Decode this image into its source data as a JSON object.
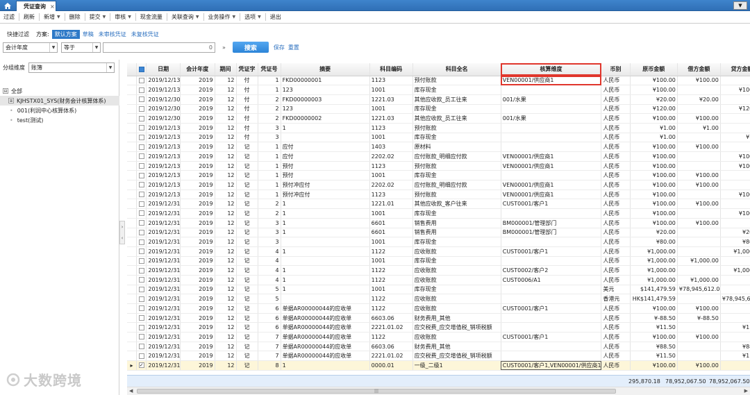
{
  "tabs": {
    "home_icon": "home-icon",
    "active": "凭证查询",
    "close": "×",
    "corner": "▼"
  },
  "menu": [
    {
      "label": "过滤",
      "dd": false
    },
    {
      "label": "刷新",
      "dd": false
    },
    {
      "label": "新增",
      "dd": true
    },
    {
      "label": "删除",
      "dd": false
    },
    {
      "label": "提交",
      "dd": true
    },
    {
      "label": "审核",
      "dd": true
    },
    {
      "label": "现金流量",
      "dd": false
    },
    {
      "label": "关联查询",
      "dd": true
    },
    {
      "label": "业务操作",
      "dd": true
    },
    {
      "label": "选项",
      "dd": true
    },
    {
      "label": "退出",
      "dd": false
    }
  ],
  "filter": {
    "quick": "快捷过滤",
    "scheme": "方案:",
    "active_scheme": "默认方案",
    "links": [
      "草稿",
      "未审核凭证",
      "未复核凭证"
    ]
  },
  "condition": {
    "field": "会计年度",
    "op": "等于",
    "value": "0",
    "search": "搜索",
    "save": "保存",
    "reset": "重置"
  },
  "group": {
    "label": "分组维度",
    "value": "账簿"
  },
  "tree": [
    {
      "label": "全部",
      "level": 1,
      "toggle": "⊟",
      "selected": false
    },
    {
      "label": "KJHSTX01_SYS(财务会计核算体系)",
      "level": 2,
      "toggle": "⊞",
      "selected": true
    },
    {
      "label": "001(利润中心核算体系)",
      "level": 3,
      "toggle": "",
      "selected": false
    },
    {
      "label": "test(测试)",
      "level": 3,
      "toggle": "",
      "selected": false
    }
  ],
  "columns": [
    "日期",
    "会计年度",
    "期间",
    "凭证字",
    "凭证号",
    "摘要",
    "科目编码",
    "科目全名",
    "核算维度",
    "币别",
    "原币金额",
    "借方金额",
    "贷方金额"
  ],
  "highlight_column": "核算维度",
  "rows": [
    [
      "2019/12/13",
      "2019",
      "12",
      "付",
      "1",
      "FKD00000001",
      "1123",
      "预付账款",
      "VEN00001/供应商1",
      "人民币",
      "¥100.00",
      "¥100.00",
      ""
    ],
    [
      "2019/12/13",
      "2019",
      "12",
      "付",
      "1",
      "123",
      "1001",
      "库存现金",
      "",
      "人民币",
      "¥100.00",
      "",
      "¥100.00"
    ],
    [
      "2019/12/30",
      "2019",
      "12",
      "付",
      "2",
      "FKD00000003",
      "1221.03",
      "其他应收款_员工往来",
      "001/水果",
      "人民币",
      "¥20.00",
      "¥20.00",
      ""
    ],
    [
      "2019/12/30",
      "2019",
      "12",
      "付",
      "2",
      "123",
      "1001",
      "库存现金",
      "",
      "人民币",
      "¥120.00",
      "",
      "¥120.00"
    ],
    [
      "2019/12/30",
      "2019",
      "12",
      "付",
      "2",
      "FKD00000002",
      "1221.03",
      "其他应收款_员工往来",
      "001/水果",
      "人民币",
      "¥100.00",
      "¥100.00",
      ""
    ],
    [
      "2019/12/13",
      "2019",
      "12",
      "付",
      "3",
      "1",
      "1123",
      "预付账款",
      "",
      "人民币",
      "¥1.00",
      "¥1.00",
      ""
    ],
    [
      "2019/12/13",
      "2019",
      "12",
      "付",
      "3",
      "",
      "1001",
      "库存现金",
      "",
      "人民币",
      "¥1.00",
      "",
      "¥1.00"
    ],
    [
      "2019/12/13",
      "2019",
      "12",
      "记",
      "1",
      "应付",
      "1403",
      "原材料",
      "",
      "人民币",
      "¥100.00",
      "¥100.00",
      ""
    ],
    [
      "2019/12/13",
      "2019",
      "12",
      "记",
      "1",
      "应付",
      "2202.02",
      "应付账款_明细应付款",
      "VEN00001/供应商1",
      "人民币",
      "¥100.00",
      "",
      "¥100.00"
    ],
    [
      "2019/12/13",
      "2019",
      "12",
      "记",
      "1",
      "预付",
      "1123",
      "预付账款",
      "VEN00001/供应商1",
      "人民币",
      "¥100.00",
      "",
      "¥100.00"
    ],
    [
      "2019/12/13",
      "2019",
      "12",
      "记",
      "1",
      "预付",
      "1001",
      "库存现金",
      "",
      "人民币",
      "¥100.00",
      "¥100.00",
      ""
    ],
    [
      "2019/12/13",
      "2019",
      "12",
      "记",
      "1",
      "预付冲应付",
      "2202.02",
      "应付账款_明细应付款",
      "VEN00001/供应商1",
      "人民币",
      "¥100.00",
      "¥100.00",
      ""
    ],
    [
      "2019/12/13",
      "2019",
      "12",
      "记",
      "1",
      "预付冲应付",
      "1123",
      "预付账款",
      "VEN00001/供应商1",
      "人民币",
      "¥100.00",
      "",
      "¥100.00"
    ],
    [
      "2019/12/31",
      "2019",
      "12",
      "记",
      "2",
      "1",
      "1221.01",
      "其他应收款_客户往来",
      "CUST0001/客户1",
      "人民币",
      "¥100.00",
      "¥100.00",
      ""
    ],
    [
      "2019/12/31",
      "2019",
      "12",
      "记",
      "2",
      "1",
      "1001",
      "库存现金",
      "",
      "人民币",
      "¥100.00",
      "",
      "¥100.00"
    ],
    [
      "2019/12/31",
      "2019",
      "12",
      "记",
      "3",
      "1",
      "6601",
      "销售费用",
      "BM000001/管理部门",
      "人民币",
      "¥100.00",
      "¥100.00",
      ""
    ],
    [
      "2019/12/31",
      "2019",
      "12",
      "记",
      "3",
      "1",
      "6601",
      "销售费用",
      "BM000001/管理部门",
      "人民币",
      "¥20.00",
      "",
      "¥20.00"
    ],
    [
      "2019/12/31",
      "2019",
      "12",
      "记",
      "3",
      "",
      "1001",
      "库存现金",
      "",
      "人民币",
      "¥80.00",
      "",
      "¥80.00"
    ],
    [
      "2019/12/31",
      "2019",
      "12",
      "记",
      "4",
      "1",
      "1122",
      "应收账款",
      "CUST0001/客户1",
      "人民币",
      "¥1,000.00",
      "",
      "¥1,000.00"
    ],
    [
      "2019/12/31",
      "2019",
      "12",
      "记",
      "4",
      "",
      "1001",
      "库存现金",
      "",
      "人民币",
      "¥1,000.00",
      "¥1,000.00",
      ""
    ],
    [
      "2019/12/31",
      "2019",
      "12",
      "记",
      "4",
      "1",
      "1122",
      "应收账款",
      "CUST0002/客户2",
      "人民币",
      "¥1,000.00",
      "",
      "¥1,000.00"
    ],
    [
      "2019/12/31",
      "2019",
      "12",
      "记",
      "4",
      "1",
      "1122",
      "应收账款",
      "CUST0006/A1",
      "人民币",
      "¥1,000.00",
      "¥1,000.00",
      ""
    ],
    [
      "2019/12/31",
      "2019",
      "12",
      "记",
      "5",
      "1",
      "1001",
      "库存现金",
      "",
      "美元",
      "$141,479.59",
      "¥78,945,612.00",
      ""
    ],
    [
      "2019/12/31",
      "2019",
      "12",
      "记",
      "5",
      "",
      "1122",
      "应收账款",
      "",
      "香港元",
      "HK$141,479.59",
      "",
      "¥78,945,612.00"
    ],
    [
      "2019/12/31",
      "2019",
      "12",
      "记",
      "6",
      "单据AR00000044的应收单",
      "1122",
      "应收账款",
      "CUST0001/客户1",
      "人民币",
      "¥100.00",
      "¥100.00",
      ""
    ],
    [
      "2019/12/31",
      "2019",
      "12",
      "记",
      "6",
      "单据AR00000044的应收单",
      "6603.06",
      "财务费用_其他",
      "",
      "人民币",
      "¥-88.50",
      "¥-88.50",
      ""
    ],
    [
      "2019/12/31",
      "2019",
      "12",
      "记",
      "6",
      "单据AR00000044的应收单",
      "2221.01.02",
      "应交税费_应交增值税_销项税额",
      "",
      "人民币",
      "¥11.50",
      "",
      "¥11.50"
    ],
    [
      "2019/12/31",
      "2019",
      "12",
      "记",
      "7",
      "单据AR00000044的应收单",
      "1122",
      "应收账款",
      "CUST0001/客户1",
      "人民币",
      "¥100.00",
      "¥100.00",
      ""
    ],
    [
      "2019/12/31",
      "2019",
      "12",
      "记",
      "7",
      "单据AR00000044的应收单",
      "6603.06",
      "财务费用_其他",
      "",
      "人民币",
      "¥88.50",
      "",
      "¥88.50"
    ],
    [
      "2019/12/31",
      "2019",
      "12",
      "记",
      "7",
      "单据AR00000044的应收单",
      "2221.01.02",
      "应交税费_应交增值税_销项税额",
      "",
      "人民币",
      "¥11.50",
      "",
      "¥11.50"
    ],
    [
      "2019/12/31",
      "2019",
      "12",
      "记",
      "8",
      "1",
      "0000.01",
      "一级_二级1",
      "CUST0001/客户1,VEN00001/供应商1",
      "人民币",
      "¥100.00",
      "¥100.00",
      ""
    ]
  ],
  "current_row": 30,
  "totals": {
    "orig": "295,870.18",
    "debit": "78,952,067.50",
    "credit": "78,952,067.50"
  },
  "watermark": "大数跨境"
}
